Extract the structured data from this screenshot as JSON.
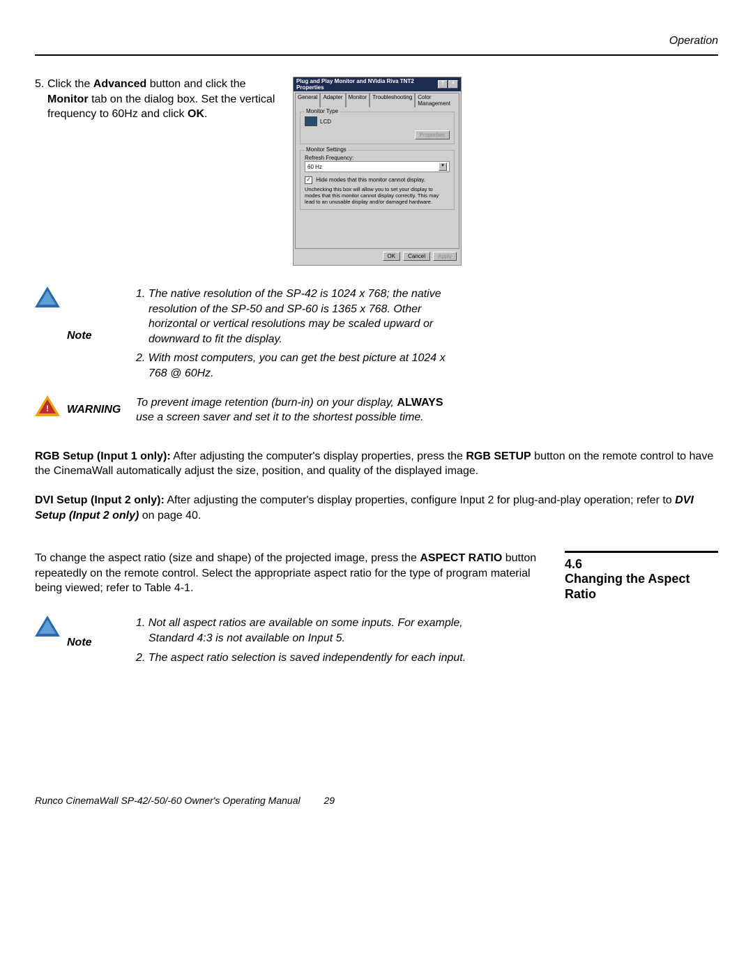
{
  "header": {
    "section": "Operation"
  },
  "step5": {
    "num": "5.",
    "text_parts": [
      "Click the ",
      "Advanced",
      " button and click the ",
      "Monitor",
      " tab on the dialog box. Set the vertical frequency to 60Hz and click ",
      "OK",
      "."
    ]
  },
  "dialog": {
    "title": "Plug and Play Monitor and NVidia Riva TNT2 Properties",
    "btn_help": "?",
    "btn_close": "×",
    "tabs": [
      "General",
      "Adapter",
      "Monitor",
      "Troubleshooting",
      "Color Management"
    ],
    "active_tab_index": 2,
    "monitor_type": {
      "legend": "Monitor Type",
      "value": "LCD",
      "properties_btn": "Properties"
    },
    "monitor_settings": {
      "legend": "Monitor Settings",
      "refresh_label": "Refresh Frequency:",
      "refresh_value": "60 Hz",
      "hide_label": "Hide modes that this monitor cannot display.",
      "hide_note": "Unchecking this box will allow you to set your display to modes that this monitor cannot display correctly. This may lead to an unusable display and/or damaged hardware."
    },
    "buttons": {
      "ok": "OK",
      "cancel": "Cancel",
      "apply": "Apply"
    }
  },
  "note1": {
    "label": "Note",
    "item1": "1. The native resolution of the SP-42 is 1024 x 768; the native resolution of the SP-50 and SP-60 is 1365 x 768. Other horizontal or vertical resolutions may be scaled upward or downward to fit the display.",
    "item2": "2. With most computers, you can get the best picture at 1024 x 768 @ 60Hz."
  },
  "warning": {
    "label": "WARNING",
    "text_pre": "To prevent image retention (burn-in) on your display, ",
    "bold": "ALWAYS",
    "text_post": " use a screen saver and set it to the shortest possible time."
  },
  "rgb_setup": {
    "title": "RGB Setup (Input 1 only):",
    "text": " After adjusting the computer's display properties, press the ",
    "bold2": "RGB SETUP",
    "text2": " button on the remote control to have the CinemaWall automatically adjust the size, position, and quality of the displayed image."
  },
  "dvi_setup": {
    "title": "DVI Setup (Input 2 only):",
    "text": " After adjusting the computer's display properties, configure Input 2 for plug-and-play operation; refer to ",
    "bolditalic": "DVI Setup (Input 2 only)",
    "text2": " on page 40."
  },
  "aspect_intro": {
    "p1a": "To change the aspect ratio (size and shape) of the projected image, press the ",
    "p1b": "ASPECT RATIO",
    "p1c": " button repeatedly on the remote control. Select the appropriate aspect ratio for the type of program material being viewed; refer to Table 4-1."
  },
  "section": {
    "num": "4.6",
    "title": "Changing the Aspect Ratio"
  },
  "note2": {
    "label": "Note",
    "item1": "1. Not all aspect ratios are available on some inputs. For example, Standard 4:3 is not available on Input 5.",
    "item2": "2. The aspect ratio selection is saved independently for each input."
  },
  "footer": {
    "text": "Runco CinemaWall SP-42/-50/-60 Owner's Operating Manual",
    "page": "29"
  }
}
